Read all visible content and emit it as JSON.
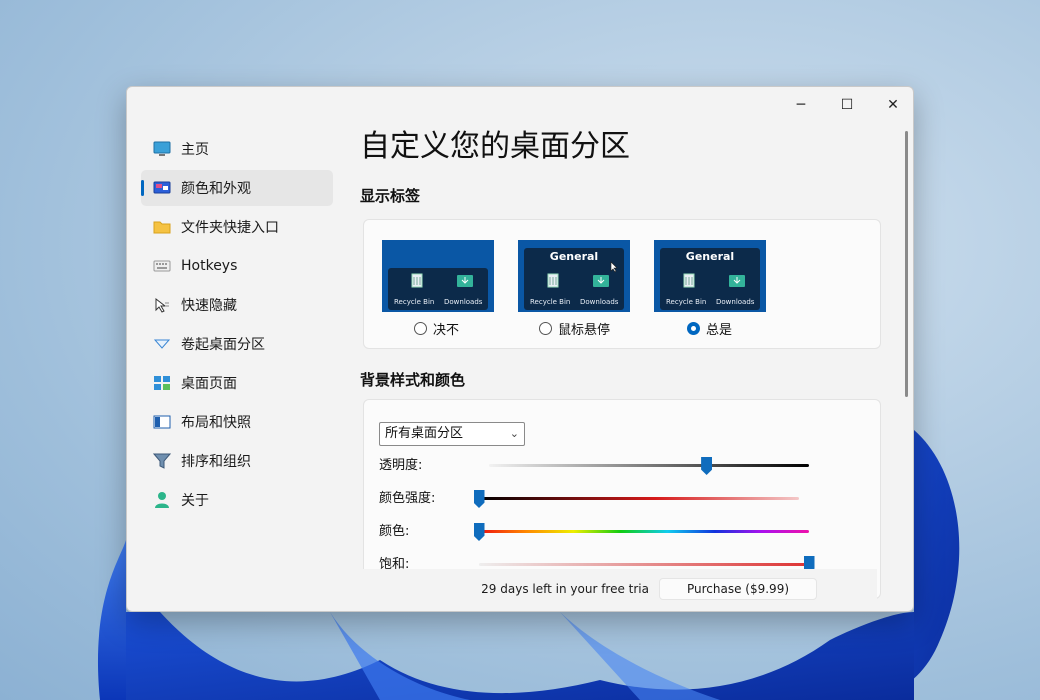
{
  "window": {
    "controls": {
      "minimize": "─",
      "maximize": "☐",
      "close": "✕"
    }
  },
  "sidebar": {
    "items": [
      {
        "label": "主页",
        "icon": "monitor-icon"
      },
      {
        "label": "颜色和外观",
        "icon": "palette-monitor-icon",
        "active": true
      },
      {
        "label": "文件夹快捷入口",
        "icon": "folder-icon"
      },
      {
        "label": "Hotkeys",
        "icon": "keyboard-icon"
      },
      {
        "label": "快速隐藏",
        "icon": "cursor-hide-icon"
      },
      {
        "label": "卷起桌面分区",
        "icon": "rollup-triangle-icon"
      },
      {
        "label": "桌面页面",
        "icon": "desktop-pages-icon"
      },
      {
        "label": "布局和快照",
        "icon": "layout-snapshot-icon"
      },
      {
        "label": "排序和组织",
        "icon": "filter-funnel-icon"
      },
      {
        "label": "关于",
        "icon": "person-icon"
      }
    ]
  },
  "main": {
    "title": "自定义您的桌面分区",
    "labels_section": {
      "heading": "显示标签",
      "options": [
        {
          "label": "决不",
          "header": "",
          "selected": false
        },
        {
          "label": "鼠标悬停",
          "header": "General",
          "selected": false
        },
        {
          "label": "总是",
          "header": "General",
          "selected": true
        }
      ],
      "thumb_captions": {
        "recycle": "Recycle Bin",
        "downloads": "Downloads"
      }
    },
    "background_section": {
      "heading": "背景样式和颜色",
      "dropdown_value": "所有桌面分区",
      "sliders": [
        {
          "label": "透明度:",
          "value": 0.68
        },
        {
          "label": "颜色强度:",
          "value": 0.0
        },
        {
          "label": "颜色:",
          "value": 0.0
        },
        {
          "label": "饱和:",
          "value": 1.0
        }
      ]
    }
  },
  "footer": {
    "trial_text": "29 days left in your free tria",
    "purchase_label": "Purchase ($9.99)"
  },
  "colors": {
    "accent": "#0067c0",
    "thumb_bg": "#0a57a5"
  }
}
